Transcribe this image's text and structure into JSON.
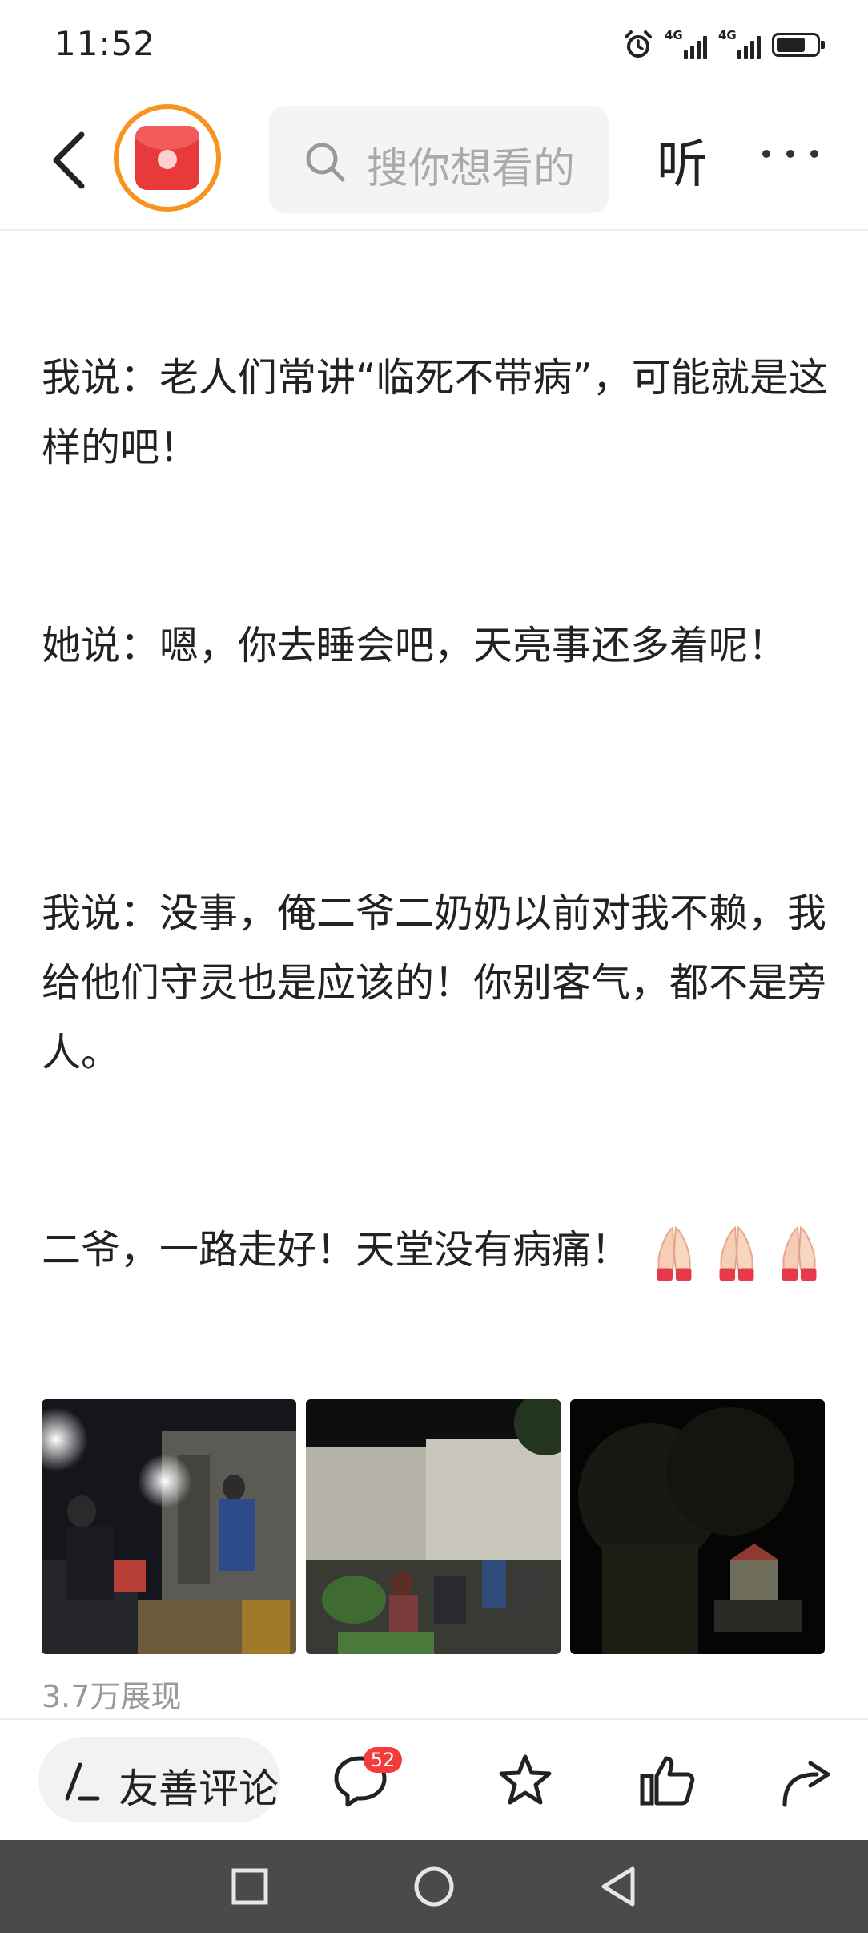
{
  "status_bar": {
    "time": "11:52",
    "network1": "4G",
    "network2": "4G",
    "battery_level": 0.72
  },
  "header": {
    "search_placeholder": "搜你想看的",
    "listen_label": "听"
  },
  "article": {
    "paragraphs": [
      "我说：老人们常讲“临死不带病”，可能就是这样的吧！",
      "她说：嗯，你去睡会吧，天亮事还多着呢！",
      "我说：没事，俺二爷二奶奶以前对我不赖，我给他们守灵也是应该的！你别客气，都不是旁人。",
      "二爷，一路走好！天堂没有病痛！"
    ],
    "emoji_name": "folded-hands",
    "views": "3.7万展现"
  },
  "action_bar": {
    "comment_label": "友善评论",
    "comment_count": "52"
  }
}
